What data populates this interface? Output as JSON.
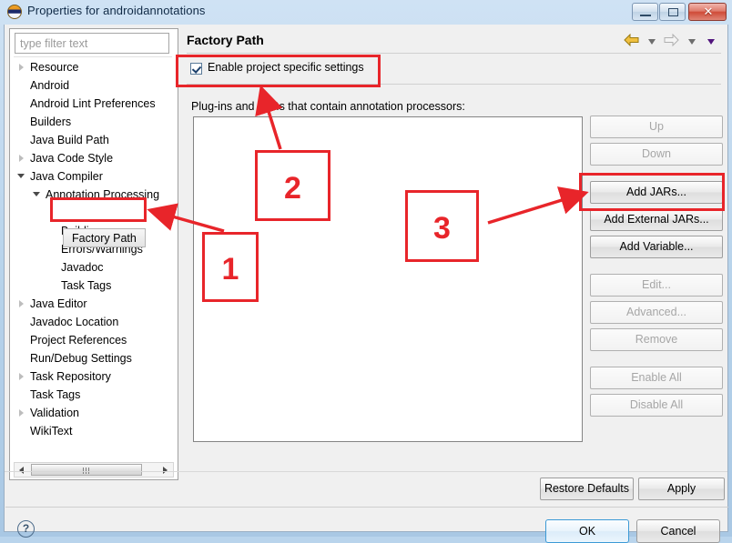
{
  "window": {
    "title": "Properties for androidannotations",
    "icon": "eclipse-icon",
    "minimize_label": "",
    "maximize_label": "",
    "close_label": "✕"
  },
  "filter": {
    "placeholder": "type filter text",
    "value": ""
  },
  "tree": {
    "items": [
      {
        "label": "Resource",
        "indent": 0,
        "twisty": "collapsed"
      },
      {
        "label": "Android",
        "indent": 0,
        "twisty": "none"
      },
      {
        "label": "Android Lint Preferences",
        "indent": 0,
        "twisty": "none"
      },
      {
        "label": "Builders",
        "indent": 0,
        "twisty": "none"
      },
      {
        "label": "Java Build Path",
        "indent": 0,
        "twisty": "none"
      },
      {
        "label": "Java Code Style",
        "indent": 0,
        "twisty": "collapsed"
      },
      {
        "label": "Java Compiler",
        "indent": 0,
        "twisty": "expanded"
      },
      {
        "label": "Annotation Processing",
        "indent": 1,
        "twisty": "expanded"
      },
      {
        "label": "",
        "indent": 2,
        "twisty": "none"
      },
      {
        "label": "Building",
        "indent": 2,
        "twisty": "none"
      },
      {
        "label": "Errors/Warnings",
        "indent": 2,
        "twisty": "none"
      },
      {
        "label": "Javadoc",
        "indent": 2,
        "twisty": "none"
      },
      {
        "label": "Task Tags",
        "indent": 2,
        "twisty": "none"
      },
      {
        "label": "Java Editor",
        "indent": 0,
        "twisty": "collapsed"
      },
      {
        "label": "Javadoc Location",
        "indent": 0,
        "twisty": "none"
      },
      {
        "label": "Project References",
        "indent": 0,
        "twisty": "none"
      },
      {
        "label": "Run/Debug Settings",
        "indent": 0,
        "twisty": "none"
      },
      {
        "label": "Task Repository",
        "indent": 0,
        "twisty": "collapsed"
      },
      {
        "label": "Task Tags",
        "indent": 0,
        "twisty": "none"
      },
      {
        "label": "Validation",
        "indent": 0,
        "twisty": "collapsed"
      },
      {
        "label": "WikiText",
        "indent": 0,
        "twisty": "none"
      }
    ],
    "selected_item": "Factory Path"
  },
  "page": {
    "title": "Factory Path",
    "enable_specific_settings_label": "Enable project specific settings",
    "enable_specific_settings_checked": true,
    "list_label": "Plug-ins and JARs that contain annotation processors:",
    "list_items": []
  },
  "side_buttons": [
    {
      "label": "Up",
      "enabled": false
    },
    {
      "label": "Down",
      "enabled": false
    },
    {
      "label": "Add JARs...",
      "enabled": true
    },
    {
      "label": "Add External JARs...",
      "enabled": true
    },
    {
      "label": "Add Variable...",
      "enabled": true
    },
    {
      "label": "Edit...",
      "enabled": false
    },
    {
      "label": "Advanced...",
      "enabled": false
    },
    {
      "label": "Remove",
      "enabled": false
    },
    {
      "label": "Enable All",
      "enabled": false
    },
    {
      "label": "Disable All",
      "enabled": false
    }
  ],
  "bottom": {
    "restore_defaults_label": "Restore Defaults",
    "apply_label": "Apply",
    "ok_label": "OK",
    "cancel_label": "Cancel",
    "help_label": "?"
  },
  "navigation": {
    "back_icon": "back-arrow-icon",
    "forward_icon": "forward-arrow-icon",
    "dropdown_icon": "chevron-down-icon"
  },
  "annotations": {
    "accent_color": "#e8252a",
    "boxes": [
      {
        "label": "1",
        "target": "factory-path-tree-item"
      },
      {
        "label": "2",
        "target": "enable-project-specific-settings-checkbox"
      },
      {
        "label": "3",
        "target": "add-jars-button"
      }
    ]
  }
}
